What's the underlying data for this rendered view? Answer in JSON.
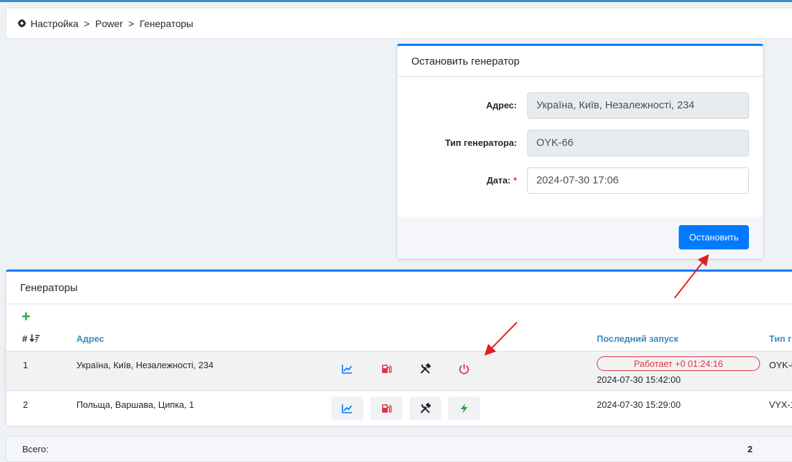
{
  "breadcrumb": {
    "icon": "gear-icon",
    "items": [
      "Настройка",
      "Power",
      "Генераторы"
    ],
    "separator": ">"
  },
  "modal": {
    "title": "Остановить генератор",
    "fields": {
      "address": {
        "label": "Адрес:",
        "value": "Україна, Київ, Незалежності, 234"
      },
      "type": {
        "label": "Тип генератора:",
        "value": "OYK-66"
      },
      "date": {
        "label": "Дата:",
        "required_mark": "*",
        "value": "2024-07-30 17:06"
      }
    },
    "submit_label": "Остановить"
  },
  "generators": {
    "title": "Генераторы",
    "headers": {
      "num": "#",
      "address": "Адрес",
      "last_start": "Последний запуск",
      "type": "Тип г"
    },
    "rows": [
      {
        "num": "1",
        "address": "Україна, Київ, Незалежності, 234",
        "status": "Работает +0 01:24:16",
        "last_start": "2024-07-30 15:42:00",
        "type": "OYK-6",
        "action_icon": "power-icon"
      },
      {
        "num": "2",
        "address": "Польща, Варшава, Ципка, 1",
        "last_start": "2024-07-30 15:29:00",
        "type": "VYX-1",
        "action_icon": "bolt-icon"
      }
    ]
  },
  "footer": {
    "label": "Всего:",
    "value": "2"
  },
  "colors": {
    "primary": "#007bff",
    "danger": "#dc3545",
    "success": "#28a745",
    "link": "#3c8dbc"
  }
}
